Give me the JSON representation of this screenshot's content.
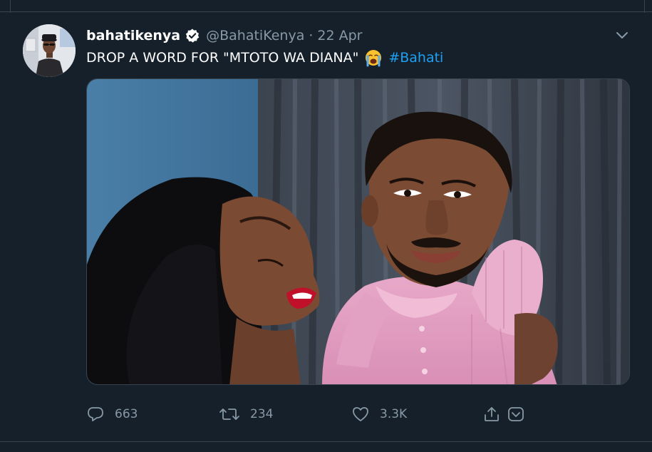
{
  "tweet": {
    "author": {
      "display_name": "bahatikenya",
      "verified": true,
      "handle": "@BahatiKenya",
      "separator": "·",
      "date": "22 Apr"
    },
    "text": "DROP A WORD FOR \"MTOTO WA DIANA\"",
    "emoji": "crying-face-emoji",
    "hashtag": "#Bahati",
    "media": {
      "description_icon": "photo"
    },
    "actions": {
      "reply_count": "663",
      "retweet_count": "234",
      "like_count": "3.3K"
    }
  },
  "colors": {
    "background": "#15202b",
    "border": "#38444d",
    "text_primary": "#ffffff",
    "text_secondary": "#8899a6",
    "link": "#1da1f2"
  }
}
